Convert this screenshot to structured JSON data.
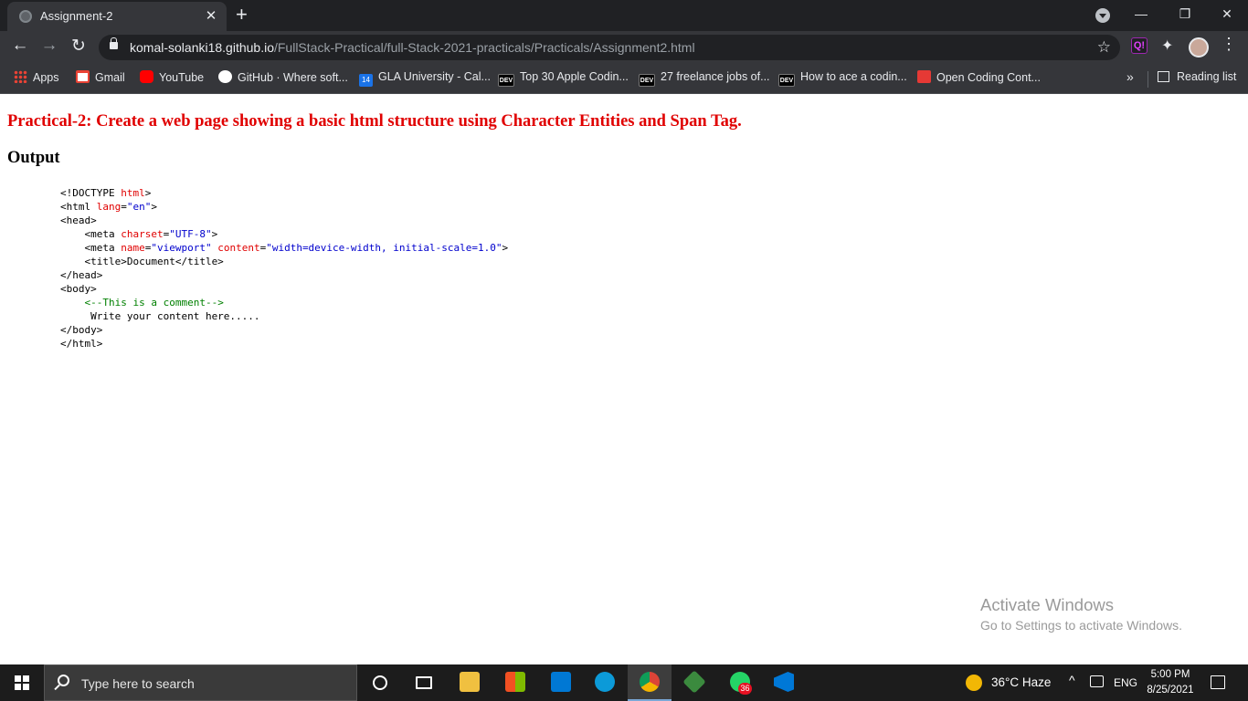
{
  "browser": {
    "tab_title": "Assignment-2",
    "tab_close": "✕",
    "new_tab": "+",
    "url_host": "komal-solanki18.github.io",
    "url_path": "/FullStack-Practical/full-Stack-2021-practicals/Practicals/Assignment2.html",
    "window": {
      "minimize": "—",
      "maximize": "❐",
      "close": "✕"
    },
    "nav": {
      "back": "←",
      "forward": "→",
      "reload": "↻"
    },
    "star": "☆",
    "ext_label": "Q!",
    "menu": "⋮",
    "bookmarks": [
      {
        "label": "Apps",
        "icon": "apps-icon"
      },
      {
        "label": "Gmail",
        "icon": "gmail-icon"
      },
      {
        "label": "YouTube",
        "icon": "youtube-icon"
      },
      {
        "label": "GitHub · Where soft...",
        "icon": "github-icon"
      },
      {
        "label": "GLA University - Cal...",
        "icon": "calendar-icon",
        "icon_text": "14"
      },
      {
        "label": "Top 30 Apple Codin...",
        "icon": "dev-icon",
        "icon_text": "DEV"
      },
      {
        "label": "27 freelance jobs of...",
        "icon": "dev-icon",
        "icon_text": "DEV"
      },
      {
        "label": "How to ace a codin...",
        "icon": "dev-icon",
        "icon_text": "DEV"
      },
      {
        "label": "Open Coding Cont...",
        "icon": "opencoding-icon"
      }
    ],
    "bookmarks_more": "»",
    "reading_list": "Reading list"
  },
  "page": {
    "heading": "Practical-2: Create a web page showing a basic html structure using Character Entities and Span Tag.",
    "output_heading": "Output",
    "code": {
      "l1_a": "<!DOCTYPE ",
      "l1_b": "html",
      "l1_c": ">",
      "l2_a": "<html ",
      "l2_attr": "lang",
      "l2_eq": "=",
      "l2_val": "\"en\"",
      "l2_c": ">",
      "l3": "<head>",
      "l4_a": "    <meta ",
      "l4_attr": "charset",
      "l4_eq": "=",
      "l4_val": "\"UTF-8\"",
      "l4_c": ">",
      "l5_a": "    <meta ",
      "l5_attr1": "name",
      "l5_eq1": "=",
      "l5_val1": "\"viewport\"",
      "l5_sp": " ",
      "l5_attr2": "content",
      "l5_eq2": "=",
      "l5_val2": "\"width=device-width, initial-scale=1.0\"",
      "l5_c": ">",
      "l6": "    <title>Document</title>",
      "l7": "</head>",
      "l8": "<body>",
      "l9_indent": "    ",
      "l9_comment": "<--This is a comment-->",
      "l10": "     Write your content here.....",
      "l11": "</body>",
      "l12": "</html>"
    },
    "activate_title": "Activate Windows",
    "activate_sub": "Go to Settings to activate Windows."
  },
  "taskbar": {
    "search_placeholder": "Type here to search",
    "apps": [
      "cortana-icon",
      "task-view-icon",
      "file-explorer-icon",
      "microsoft-store-icon",
      "mail-icon",
      "edge-icon",
      "chrome-icon",
      "git-icon",
      "whatsapp-icon",
      "vscode-icon"
    ],
    "whatsapp_badge": "36",
    "weather": "36°C  Haze",
    "caret": "^",
    "language": "ENG",
    "time": "5:00 PM",
    "date": "8/25/2021"
  },
  "colors": {
    "heading_red": "#e00000",
    "code_attr": "#e00000",
    "code_value": "#0000cd",
    "code_comment": "#008000",
    "chrome_dark": "#202124",
    "chrome_toolbar": "#35363a",
    "taskbar": "#1c1c1c"
  }
}
